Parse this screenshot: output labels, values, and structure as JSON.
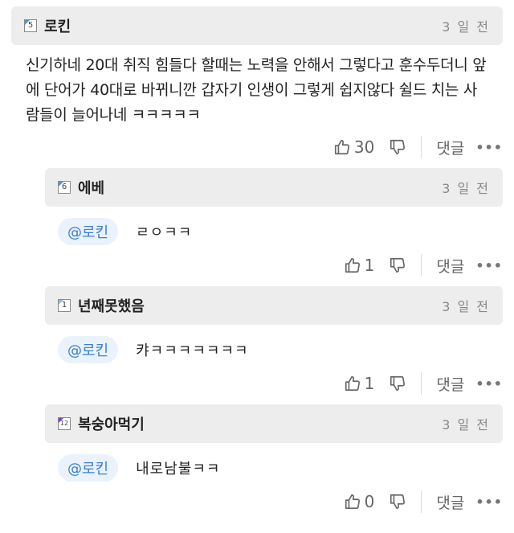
{
  "comments": [
    {
      "level": "5",
      "level_color": "#5a8fd6",
      "author": "로킨",
      "time": "3 일 전",
      "text": "신기하네 20대 취직 힘들다 할때는 노력을 안해서 그렇다고 훈수두더니 앞에 단어가 40대로 바뀌니깐 갑자기 인생이 그렇게 쉽지않다 쉴드 치는 사람들이 늘어나네 ㅋㅋㅋㅋㅋ",
      "likes": "30",
      "reply_label": "댓글",
      "more_label": "•••"
    }
  ],
  "replies": [
    {
      "level": "6",
      "level_color": "#5a8fd6",
      "author": "에베",
      "time": "3 일 전",
      "mention": "@로킨",
      "text": "ㄹㅇㅋㅋ",
      "likes": "1",
      "reply_label": "댓글",
      "more_label": "•••"
    },
    {
      "level": "1",
      "level_color": "#9bb7e0",
      "author": "년째못했음",
      "time": "3 일 전",
      "mention": "@로킨",
      "text": "캬ㅋㅋㅋㅋㅋㅋㅋ",
      "likes": "1",
      "reply_label": "댓글",
      "more_label": "•••"
    },
    {
      "level": "12",
      "level_color": "#7b3fbf",
      "author": "복숭아먹기",
      "time": "3 일 전",
      "mention": "@로킨",
      "text": "내로남불ㅋㅋ",
      "likes": "0",
      "reply_label": "댓글",
      "more_label": "•••"
    }
  ]
}
